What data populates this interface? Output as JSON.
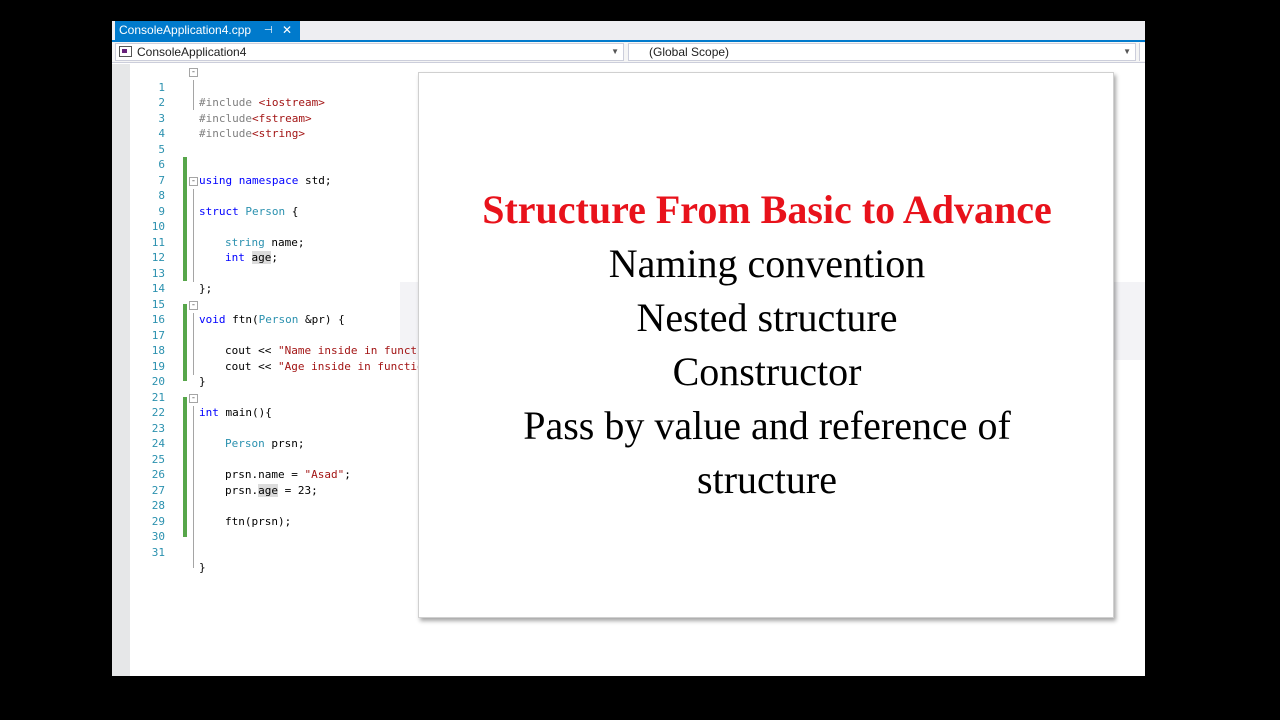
{
  "tab": {
    "title": "ConsoleApplication4.cpp",
    "pin_glyph": "⊣",
    "close_glyph": "✕"
  },
  "navbar": {
    "project": "ConsoleApplication4",
    "scope": "(Global Scope)"
  },
  "editor": {
    "line_numbers": [
      "1",
      "2",
      "3",
      "4",
      "5",
      "6",
      "7",
      "8",
      "9",
      "10",
      "11",
      "12",
      "13",
      "14",
      "15",
      "16",
      "17",
      "18",
      "19",
      "20",
      "21",
      "22",
      "23",
      "24",
      "25",
      "26",
      "27",
      "28",
      "29",
      "30",
      "31"
    ],
    "code": {
      "l1_pp": "#include ",
      "l1_hdr": "<iostream>",
      "l2_pp": "#include",
      "l2_hdr": "<fstream>",
      "l3_pp": "#include",
      "l3_hdr": "<string>",
      "l6_kw": "using namespace",
      "l6_rest": " std;",
      "l8_kw": "struct",
      "l8_sp": " ",
      "l8_typ": "Person",
      "l8_rest": " {",
      "l10_typ": "string",
      "l10_rest": " name;",
      "l11_kw": "int",
      "l11_sp": " ",
      "l11_ref": "age",
      "l11_rest": ";",
      "l13": "};",
      "l15_kw": "void",
      "l15_a": " ftn(",
      "l15_typ": "Person",
      "l15_b": " &pr) {",
      "l17_a": "cout << ",
      "l17_str": "\"Name inside in functi",
      "l18_a": "cout << ",
      "l18_str": "\"Age inside in functio",
      "l19": "}",
      "l21_kw": "int",
      "l21_rest": " main(){",
      "l23_typ": "Person",
      "l23_rest": " prsn;",
      "l25_a": "prsn.name = ",
      "l25_str": "\"Asad\"",
      "l25_b": ";",
      "l26_a": "prsn.",
      "l26_ref": "age",
      "l26_b": " = 23;",
      "l28": "ftn(prsn);",
      "l31": "}"
    }
  },
  "slide": {
    "title": "Structure From Basic to Advance",
    "lines": [
      "Naming convention",
      "Nested structure",
      "Constructor",
      "Pass by value and reference of",
      "structure"
    ],
    "title_color": "#e8121b"
  },
  "colors": {
    "accent": "#007acc",
    "keyword": "#0000ff",
    "type": "#2b91af",
    "string": "#a31515",
    "change_marker": "#57a64a"
  }
}
